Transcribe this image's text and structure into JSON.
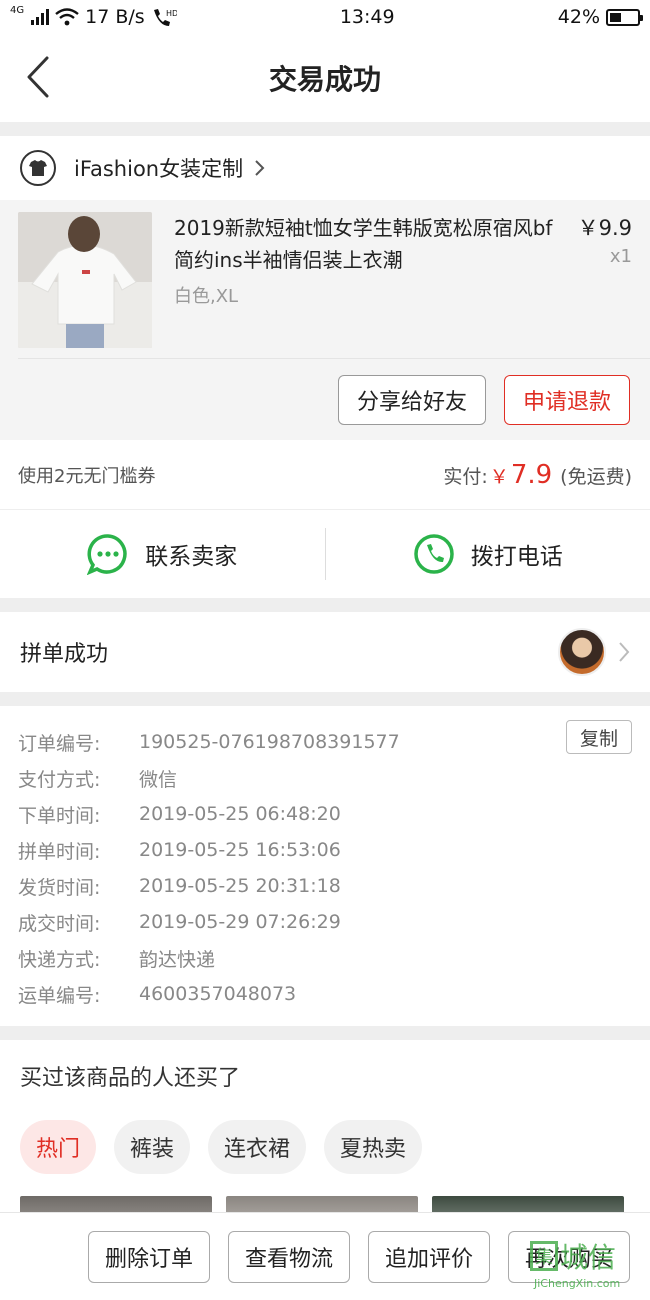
{
  "status_bar": {
    "net_type": "4G",
    "speed": "17 B/s",
    "hd": "HD",
    "time": "13:49",
    "battery": "42%",
    "battery_level": 0.42
  },
  "nav": {
    "title": "交易成功"
  },
  "shop": {
    "name": "iFashion女装定制"
  },
  "goods": {
    "title": "2019新款短袖t恤女学生韩版宽松原宿风bf简约ins半袖情侣装上衣潮",
    "spec": "白色,XL",
    "price": "￥9.9",
    "qty": "x1",
    "share_label": "分享给好友",
    "refund_label": "申请退款"
  },
  "payment": {
    "coupon": "使用2元无门槛券",
    "paid_label": "实付:",
    "currency": "￥",
    "amount": "7.9",
    "shipping_note": "(免运费)"
  },
  "contact": {
    "seller_label": "联系卖家",
    "phone_label": "拨打电话"
  },
  "group": {
    "title": "拼单成功"
  },
  "order": {
    "copy_label": "复制",
    "rows": [
      {
        "key": "订单编号:",
        "value": "190525-076198708391577"
      },
      {
        "key": "支付方式:",
        "value": "微信"
      },
      {
        "key": "下单时间:",
        "value": "2019-05-25 06:48:20"
      },
      {
        "key": "拼单时间:",
        "value": "2019-05-25 16:53:06"
      },
      {
        "key": "发货时间:",
        "value": "2019-05-25 20:31:18"
      },
      {
        "key": "成交时间:",
        "value": "2019-05-29 07:26:29"
      },
      {
        "key": "快递方式:",
        "value": "韵达快递"
      },
      {
        "key": "运单编号:",
        "value": "4600357048073"
      }
    ]
  },
  "recommend": {
    "title": "买过该商品的人还买了",
    "chips": [
      "热门",
      "裤装",
      "连衣裙",
      "夏热卖"
    ]
  },
  "bottom": {
    "delete": "删除订单",
    "logistics": "查看物流",
    "review": "追加评价",
    "rebuy": "再次购买"
  },
  "watermark": {
    "main": "城信",
    "box": "集",
    "sub": "JiChengXin.com"
  },
  "colors": {
    "accent": "#e02e24",
    "contact_green": "#2bb34a"
  }
}
